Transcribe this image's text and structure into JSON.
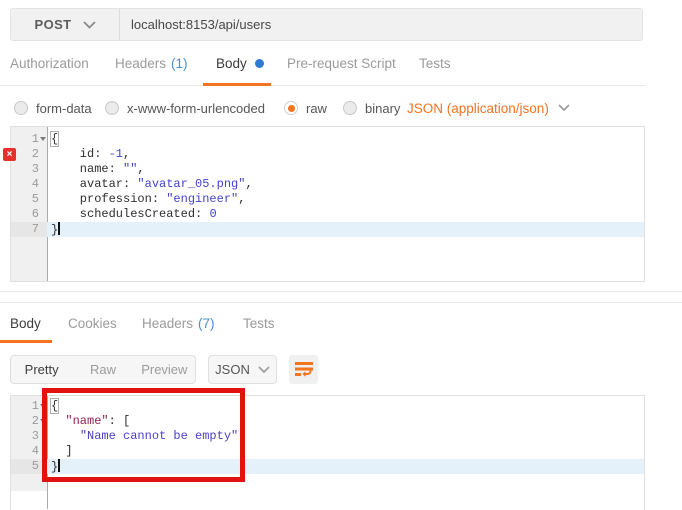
{
  "request": {
    "method": "POST",
    "url": "localhost:8153/api/users",
    "tabs": [
      {
        "label": "Authorization"
      },
      {
        "label": "Headers",
        "badge": "(1)"
      },
      {
        "label": "Body",
        "active": true,
        "dot": true
      },
      {
        "label": "Pre-request Script"
      },
      {
        "label": "Tests"
      }
    ],
    "body_modes": [
      {
        "label": "form-data"
      },
      {
        "label": "x-www-form-urlencoded"
      },
      {
        "label": "raw",
        "selected": true
      },
      {
        "label": "binary"
      }
    ],
    "content_type": "JSON (application/json)",
    "editor": {
      "lines": [
        {
          "num": 1,
          "fold": true,
          "segments": [
            {
              "t": "plain",
              "v": "{",
              "bracket": true
            }
          ]
        },
        {
          "num": 2,
          "error": true,
          "segments": [
            {
              "t": "plain",
              "v": "    id: "
            },
            {
              "t": "value",
              "v": "-1"
            },
            {
              "t": "plain",
              "v": ","
            }
          ]
        },
        {
          "num": 3,
          "segments": [
            {
              "t": "plain",
              "v": "    name: "
            },
            {
              "t": "value",
              "v": "\"\""
            },
            {
              "t": "plain",
              "v": ","
            }
          ]
        },
        {
          "num": 4,
          "segments": [
            {
              "t": "plain",
              "v": "    avatar: "
            },
            {
              "t": "value",
              "v": "\"avatar_05.png\""
            },
            {
              "t": "plain",
              "v": ","
            }
          ]
        },
        {
          "num": 5,
          "segments": [
            {
              "t": "plain",
              "v": "    profession: "
            },
            {
              "t": "value",
              "v": "\"engineer\""
            },
            {
              "t": "plain",
              "v": ","
            }
          ]
        },
        {
          "num": 6,
          "segments": [
            {
              "t": "plain",
              "v": "    schedulesCreated: "
            },
            {
              "t": "value",
              "v": "0"
            }
          ]
        },
        {
          "num": 7,
          "active": true,
          "cursor": true,
          "segments": [
            {
              "t": "plain",
              "v": "}"
            }
          ]
        }
      ]
    }
  },
  "response": {
    "tabs": [
      {
        "label": "Body",
        "active": true
      },
      {
        "label": "Cookies"
      },
      {
        "label": "Headers",
        "badge": "(7)"
      },
      {
        "label": "Tests"
      }
    ],
    "view_modes": [
      {
        "label": "Pretty",
        "active": true
      },
      {
        "label": "Raw"
      },
      {
        "label": "Preview"
      }
    ],
    "format": "JSON",
    "editor": {
      "lines": [
        {
          "num": 1,
          "fold": true,
          "segments": [
            {
              "t": "plain",
              "v": "{",
              "bracket": true
            }
          ]
        },
        {
          "num": 2,
          "fold": true,
          "segments": [
            {
              "t": "plain",
              "v": "  "
            },
            {
              "t": "key",
              "v": "\"name\""
            },
            {
              "t": "plain",
              "v": ": ["
            }
          ]
        },
        {
          "num": 3,
          "segments": [
            {
              "t": "plain",
              "v": "    "
            },
            {
              "t": "string",
              "v": "\"Name cannot be empty\""
            }
          ]
        },
        {
          "num": 4,
          "segments": [
            {
              "t": "plain",
              "v": "  ]"
            }
          ]
        },
        {
          "num": 5,
          "active": true,
          "cursor": true,
          "segments": [
            {
              "t": "plain",
              "v": "}"
            }
          ]
        }
      ]
    }
  },
  "colors": {
    "accent_orange": "#f4731f",
    "link_blue": "#4a90d2",
    "body_dot_blue": "#2d7bd0",
    "error_red": "#e5322d",
    "annotation_red": "#e11212",
    "token_value": "#4343cc",
    "token_key": "#8b2252",
    "active_line_bg": "#e4f0fa"
  }
}
